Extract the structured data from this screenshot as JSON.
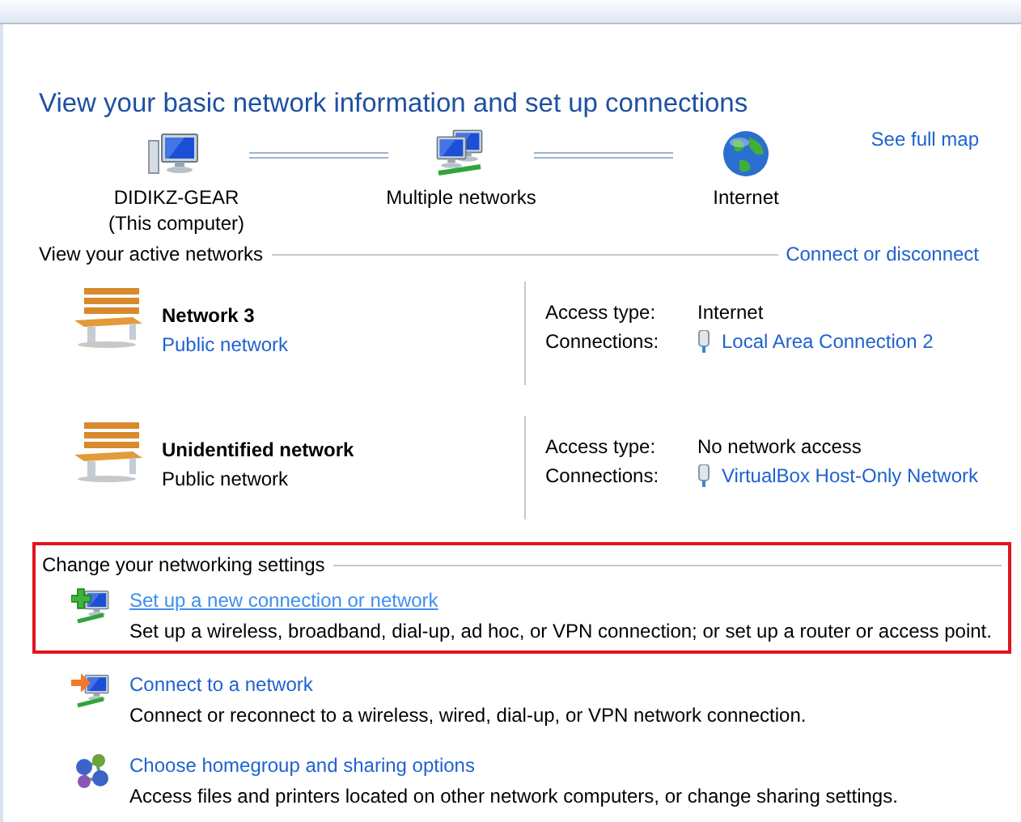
{
  "title": "View your basic network information and set up connections",
  "map": {
    "nodes": [
      {
        "kind": "computer",
        "label": "DIDIKZ-GEAR",
        "sublabel": "(This computer)"
      },
      {
        "kind": "networks",
        "label": "Multiple networks"
      },
      {
        "kind": "internet",
        "label": "Internet"
      }
    ],
    "link": "See full map"
  },
  "active": {
    "heading": "View your active networks",
    "link": "Connect or disconnect",
    "networks": [
      {
        "name": "Network 3",
        "category": "Public network",
        "category_is_link": true,
        "access_label": "Access type:",
        "access": "Internet",
        "connections_label": "Connections:",
        "connection": "Local Area Connection 2"
      },
      {
        "name": "Unidentified network",
        "category": "Public network",
        "category_is_link": false,
        "access_label": "Access type:",
        "access": "No network access",
        "connections_label": "Connections:",
        "connection": "VirtualBox Host-Only Network"
      }
    ]
  },
  "settings": {
    "heading": "Change your networking settings",
    "tasks": [
      {
        "kind": "new-connection",
        "title": "Set up a new connection or network",
        "description": "Set up a wireless, broadband, dial-up, ad hoc, or VPN connection; or set up a router or access point.",
        "hovered": true,
        "highlighted": true
      },
      {
        "kind": "connect",
        "title": "Connect to a network",
        "description": "Connect or reconnect to a wireless, wired, dial-up, or VPN network connection.",
        "hovered": false,
        "highlighted": false
      },
      {
        "kind": "homegroup",
        "title": "Choose homegroup and sharing options",
        "description": "Access files and printers located on other network computers, or change sharing settings.",
        "hovered": false,
        "highlighted": false
      }
    ]
  }
}
